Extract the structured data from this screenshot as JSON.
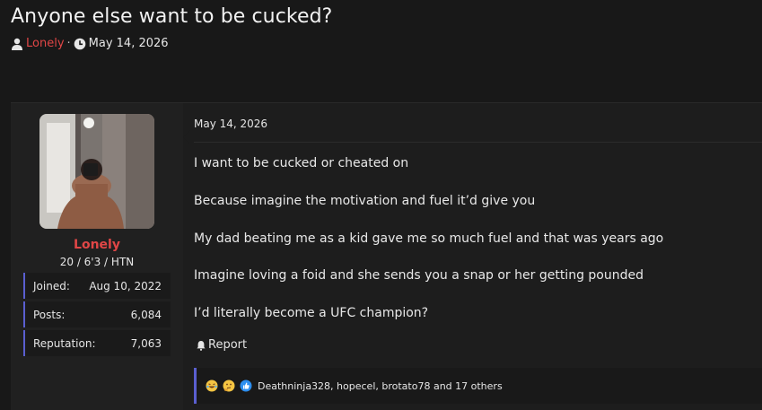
{
  "thread": {
    "title": "Anyone else want to be cucked?",
    "author": "Lonely",
    "separator": "·",
    "date": "May 14, 2026"
  },
  "user": {
    "name": "Lonely",
    "title": "20 / 6'3 / HTN",
    "stats": [
      {
        "label": "Joined:",
        "value": "Aug 10, 2022"
      },
      {
        "label": "Posts:",
        "value": "6,084"
      },
      {
        "label": "Reputation:",
        "value": "7,063"
      }
    ]
  },
  "post": {
    "date": "May 14, 2026",
    "lines": [
      "I want to be cucked or cheated on",
      "Because imagine the motivation and fuel it’d give you",
      "My dad beating me as a kid gave me so much fuel and that was years ago",
      "Imagine loving a foid and she sends you a snap or her getting pounded",
      "I’d literally become a UFC champion?"
    ],
    "report_label": "Report"
  },
  "reactions": {
    "icons": [
      "laughing-face-icon",
      "thinking-face-icon",
      "thumbs-up-icon"
    ],
    "names": "Deathninja328, hopecel, brotato78 and 17 others"
  },
  "colors": {
    "accent": "#5a5fd0",
    "username": "#e04646",
    "background": "#181818"
  }
}
